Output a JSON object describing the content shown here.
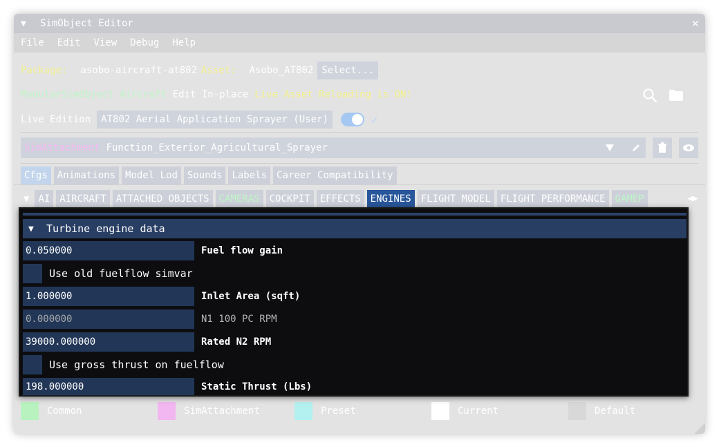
{
  "window": {
    "title": "SimObject Editor",
    "close_glyph": "✕"
  },
  "menu": [
    "File",
    "Edit",
    "View",
    "Debug",
    "Help"
  ],
  "package_row": {
    "package_label": "Package:",
    "package_value": "asobo-aircraft-at802",
    "asset_label": "Asset:",
    "asset_value": "Asobo_AT802",
    "select_button": "Select..."
  },
  "mode_row": {
    "modular": "ModularSimObject Aircraft",
    "edit_inplace": "Edit In-place",
    "live_reload": "Live Asset Reloading is ON!"
  },
  "live_edition": {
    "label": "Live Edition",
    "value": "AT802 Aerial Application Sprayer (User)",
    "toggle_on": true
  },
  "attachment": {
    "type_label": "SimAttachment",
    "name": "Function_Exterior_Agricultural_Sprayer"
  },
  "tabs_primary": [
    "Cfgs",
    "Animations",
    "Model Lod",
    "Sounds",
    "Labels",
    "Career Compatibility"
  ],
  "tabs_secondary": [
    {
      "label": "AI",
      "green": false
    },
    {
      "label": "AIRCRAFT",
      "green": false
    },
    {
      "label": "ATTACHED OBJECTS",
      "green": false
    },
    {
      "label": "CAMERAS",
      "green": true
    },
    {
      "label": "COCKPIT",
      "green": false
    },
    {
      "label": "EFFECTS",
      "green": false
    },
    {
      "label": "ENGINES",
      "green": false,
      "active": true
    },
    {
      "label": "FLIGHT MODEL",
      "green": false
    },
    {
      "label": "FLIGHT PERFORMANCE",
      "green": false
    },
    {
      "label": "GAMEP",
      "green": true
    }
  ],
  "section": {
    "title": "Turbine engine data",
    "fields": [
      {
        "type": "input",
        "value": "0.050000",
        "label": "Fuel flow gain",
        "dim": false
      },
      {
        "type": "check",
        "label": "Use old fuelflow simvar"
      },
      {
        "type": "input",
        "value": "1.000000",
        "label": "Inlet Area (sqft)",
        "dim": false
      },
      {
        "type": "input",
        "value": "0.000000",
        "label": "N1 100 PC RPM",
        "dim": true
      },
      {
        "type": "input",
        "value": "39000.000000",
        "label": "Rated N2 RPM",
        "dim": false
      },
      {
        "type": "check",
        "label": "Use gross thrust on fuelflow"
      },
      {
        "type": "input",
        "value": "198.000000",
        "label": "Static Thrust (Lbs)",
        "dim": false
      }
    ]
  },
  "legend": [
    {
      "label": "Common",
      "color": "#b8f2bf"
    },
    {
      "label": "SimAttachment",
      "color": "#f2b6f0"
    },
    {
      "label": "Preset",
      "color": "#b3f0f0"
    },
    {
      "label": "Current",
      "color": "#ffffff"
    },
    {
      "label": "Default",
      "color": "#d8d8d8"
    }
  ],
  "colors": {
    "active_tab": "#28569a",
    "panel_bg": "#0d0d10",
    "input_bg": "#223758",
    "header_bg": "#283e63"
  }
}
